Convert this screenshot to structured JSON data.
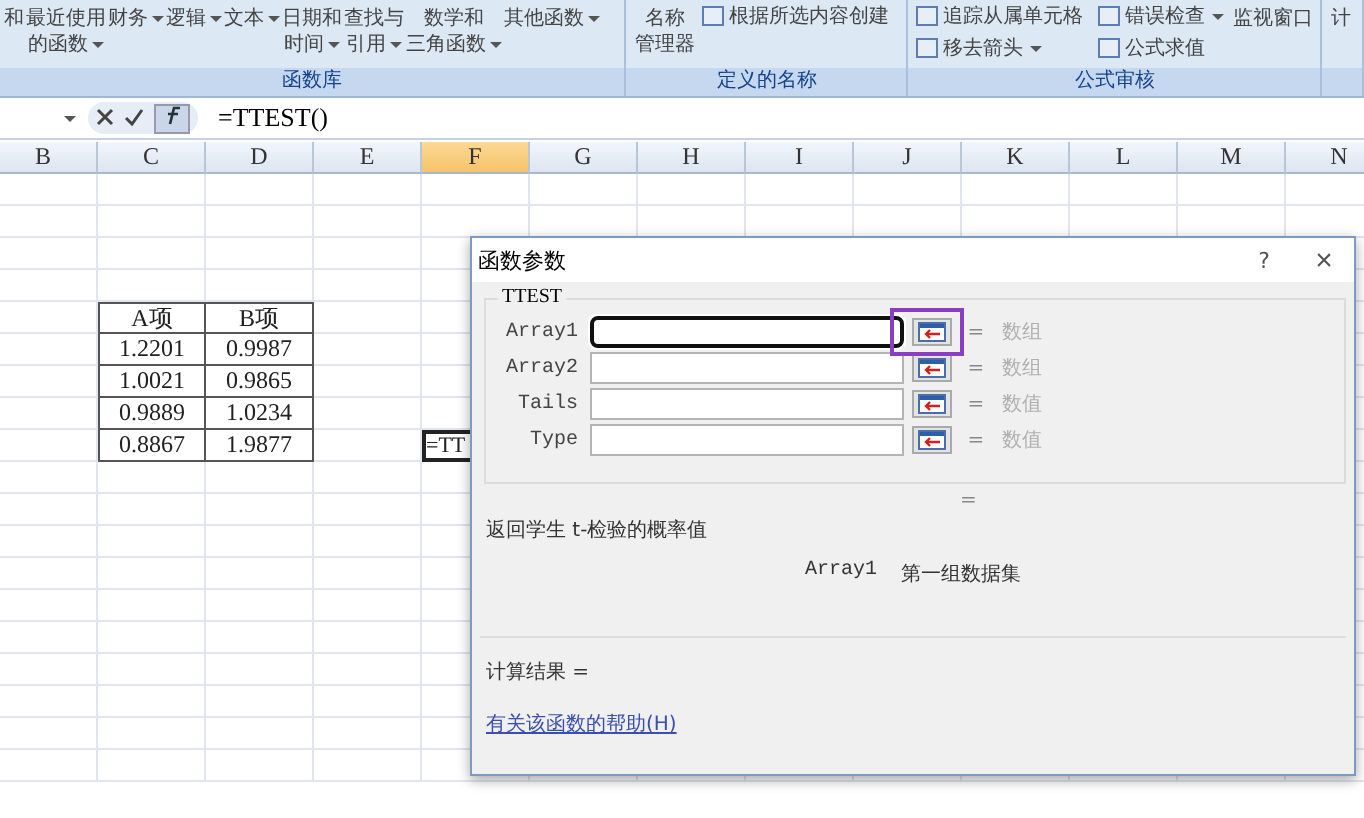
{
  "ribbon": {
    "groups": [
      {
        "label": "函数库",
        "items": [
          {
            "lines": [
              "和"
            ],
            "caret": false
          },
          {
            "lines": [
              "最近使用",
              "的函数"
            ],
            "caret": true
          },
          {
            "lines": [
              "财务"
            ],
            "caret": true
          },
          {
            "lines": [
              "逻辑"
            ],
            "caret": true
          },
          {
            "lines": [
              "文本"
            ],
            "caret": true
          },
          {
            "lines": [
              "日期和",
              "时间"
            ],
            "caret": true
          },
          {
            "lines": [
              "查找与",
              "引用"
            ],
            "caret": true
          },
          {
            "lines": [
              "数学和",
              "三角函数"
            ],
            "caret": true
          },
          {
            "lines": [
              "其他函数"
            ],
            "caret": true
          }
        ]
      },
      {
        "label": "定义的名称",
        "items": [
          {
            "lines": [
              "名称",
              "管理器"
            ],
            "caret": false
          }
        ],
        "small": [
          {
            "label": "根据所选内容创建",
            "caret": false
          }
        ]
      },
      {
        "label": "公式审核",
        "small": [
          {
            "label": "追踪从属单元格",
            "caret": false
          },
          {
            "label": "错误检查",
            "caret": true
          },
          {
            "label": "移去箭头",
            "caret": true
          },
          {
            "label": "公式求值",
            "caret": false
          }
        ],
        "items": [
          {
            "lines": [
              "监视窗口"
            ],
            "caret": false
          }
        ]
      },
      {
        "items": [
          {
            "lines": [
              "计"
            ],
            "caret": false
          }
        ]
      }
    ]
  },
  "formula_bar": {
    "formula": "=TTEST()"
  },
  "sheet": {
    "columns": [
      {
        "label": "B",
        "selected": false
      },
      {
        "label": "C",
        "selected": false
      },
      {
        "label": "D",
        "selected": false
      },
      {
        "label": "E",
        "selected": false
      },
      {
        "label": "F",
        "selected": true
      },
      {
        "label": "G",
        "selected": false
      },
      {
        "label": "H",
        "selected": false
      },
      {
        "label": "I",
        "selected": false
      },
      {
        "label": "J",
        "selected": false
      },
      {
        "label": "K",
        "selected": false
      },
      {
        "label": "L",
        "selected": false
      },
      {
        "label": "M",
        "selected": false
      },
      {
        "label": "N",
        "selected": false
      }
    ],
    "table": {
      "headers": [
        "A项",
        "B项"
      ],
      "rows": [
        [
          "1.2201",
          "0.9987"
        ],
        [
          "1.0021",
          "0.9865"
        ],
        [
          "0.9889",
          "1.0234"
        ],
        [
          "0.8867",
          "1.9877"
        ]
      ]
    },
    "active_cell": {
      "text": "=TT"
    }
  },
  "dialog": {
    "title": "函数参数",
    "help": "?",
    "close": "×",
    "function_name": "TTEST",
    "arguments": [
      {
        "label": "Array1",
        "sign": "=",
        "hint": "数组",
        "focused": true,
        "highlighted": true
      },
      {
        "label": "Array2",
        "sign": "=",
        "hint": "数组",
        "focused": false,
        "highlighted": false
      },
      {
        "label": "Tails",
        "sign": "=",
        "hint": "数值",
        "focused": false,
        "highlighted": false
      },
      {
        "label": "Type",
        "sign": "=",
        "hint": "数值",
        "focused": false,
        "highlighted": false
      }
    ],
    "result_sign": "=",
    "description": "返回学生 t-检验的概率值",
    "argument_name": "Array1",
    "argument_description": "第一组数据集",
    "result_label": "计算结果 =",
    "help_link": "有关该函数的帮助(H)"
  }
}
